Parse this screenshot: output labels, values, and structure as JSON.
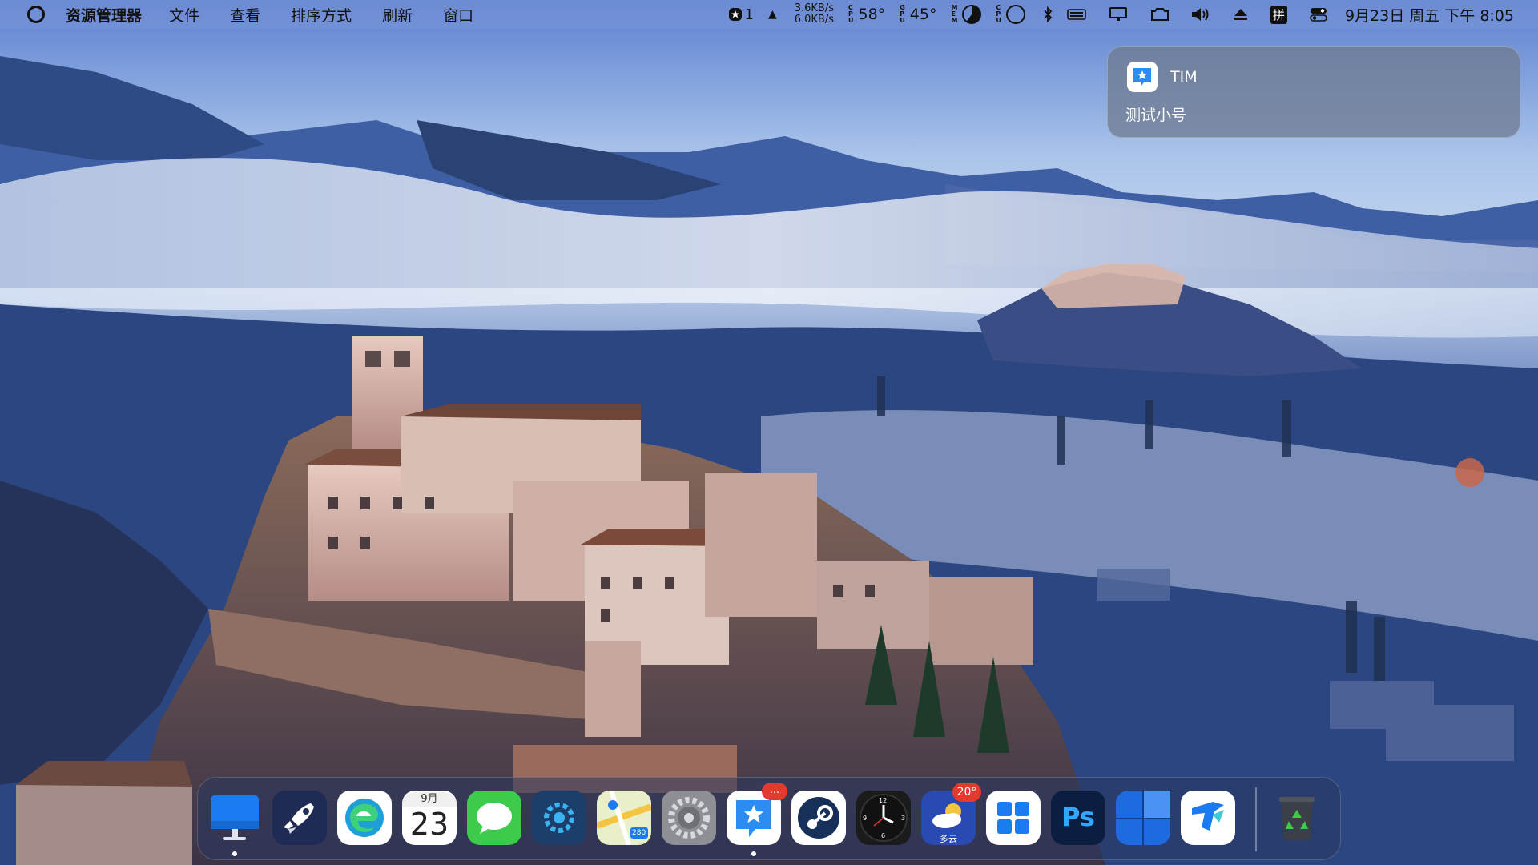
{
  "menubar": {
    "app_name": "资源管理器",
    "items": [
      "文件",
      "查看",
      "排序方式",
      "刷新",
      "窗口"
    ],
    "status": {
      "badge_count": "1",
      "net_up": "3.6KB/s",
      "net_down": "6.0KB/s",
      "cpu_temp": "58°",
      "gpu_temp": "45°",
      "ime": "拼",
      "datetime": "9月23日 周五 下午 8:05"
    }
  },
  "notification": {
    "app": "TIM",
    "message": "测试小号"
  },
  "dock": {
    "apps": [
      {
        "name": "访达"
      },
      {
        "name": "启动台"
      },
      {
        "name": "Microsoft Edge"
      },
      {
        "name": "日历",
        "month": "9月",
        "day": "23"
      },
      {
        "name": "信息"
      },
      {
        "name": "设置工具"
      },
      {
        "name": "地图",
        "label": "280"
      },
      {
        "name": "系统偏好设置"
      },
      {
        "name": "TIM",
        "badge": "..."
      },
      {
        "name": "Steam"
      },
      {
        "name": "时钟",
        "hours": [
          "12",
          "1",
          "2",
          "3",
          "4",
          "5",
          "6",
          "7",
          "8",
          "9",
          "10",
          "11"
        ]
      },
      {
        "name": "天气",
        "temp": "20°",
        "label": "多云"
      },
      {
        "name": "开始菜单"
      },
      {
        "name": "Photoshop",
        "label": "Ps"
      },
      {
        "name": "窗口"
      },
      {
        "name": "腾讯文档"
      },
      {
        "name": "回收站"
      }
    ]
  },
  "colors": {
    "menubar_bg": "#7896d7",
    "dock_bg": "#28375f",
    "badge_red": "#e23b2e"
  }
}
